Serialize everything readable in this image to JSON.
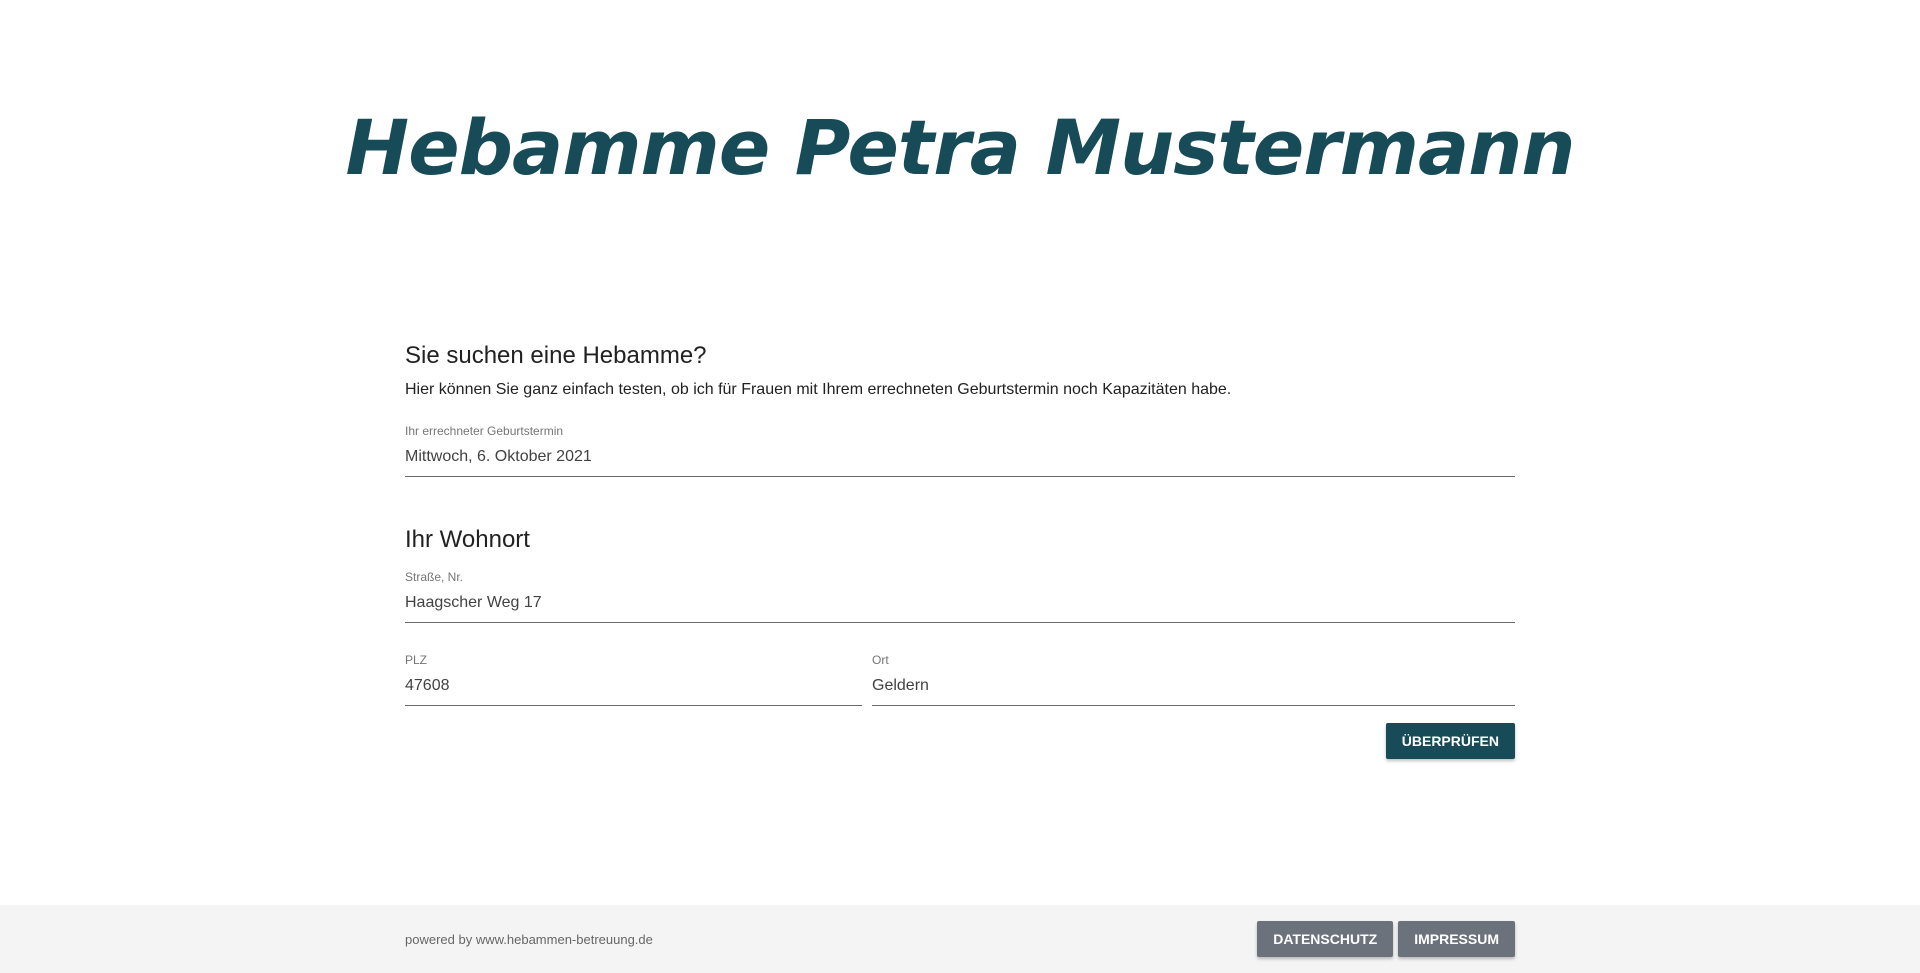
{
  "header": {
    "title": "Hebamme Petra Mustermann"
  },
  "search": {
    "heading": "Sie suchen eine Hebamme?",
    "intro": "Hier können Sie ganz einfach testen, ob ich für Frauen mit Ihrem errechneten Geburtstermin noch Kapazitäten habe.",
    "due_date": {
      "label": "Ihr errechneter Geburtstermin",
      "value": "Mittwoch, 6. Oktober 2021"
    }
  },
  "residence": {
    "heading": "Ihr Wohnort",
    "street": {
      "label": "Straße, Nr.",
      "value": "Haagscher Weg 17"
    },
    "zip": {
      "label": "PLZ",
      "value": "47608"
    },
    "city": {
      "label": "Ort",
      "value": "Geldern"
    },
    "check_button": "ÜBERPRÜFEN"
  },
  "footer": {
    "powered_by": "powered by www.hebammen-betreuung.de",
    "privacy_button": "DATENSCHUTZ",
    "imprint_button": "IMPRESSUM"
  },
  "colors": {
    "brand": "#164b57",
    "footer_button": "#6c727b",
    "footer_bg": "#f4f4f4"
  }
}
